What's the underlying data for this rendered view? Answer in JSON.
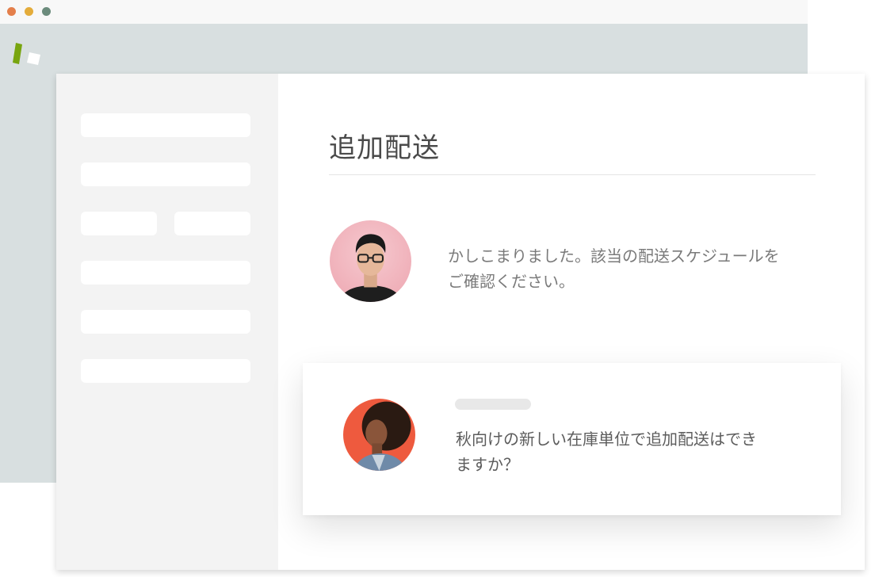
{
  "window": {
    "controls": [
      "close",
      "minimize",
      "maximize"
    ],
    "colors": {
      "close": "#e47f4b",
      "minimize": "#e4ac3b",
      "maximize": "#6b8b7c",
      "chrome": "#d8dfe0"
    }
  },
  "logo": {
    "icon": "brand-logo-icon",
    "colors": [
      "#78a50f",
      "#ffffff"
    ]
  },
  "sidebar": {
    "items": [
      {
        "type": "placeholder"
      },
      {
        "type": "placeholder"
      },
      {
        "type": "placeholder-pair"
      },
      {
        "type": "placeholder"
      },
      {
        "type": "placeholder"
      },
      {
        "type": "placeholder"
      }
    ]
  },
  "main": {
    "title": "追加配送",
    "messages": [
      {
        "avatar": "agent-avatar",
        "text_lines": [
          "かしこまりました。該当の配送スケジュールを",
          "ご確認ください。"
        ]
      }
    ]
  },
  "incoming_card": {
    "avatar": "customer-avatar",
    "text_lines": [
      "秋向けの新しい在庫単位で追加配送はでき",
      "ますか？"
    ]
  }
}
